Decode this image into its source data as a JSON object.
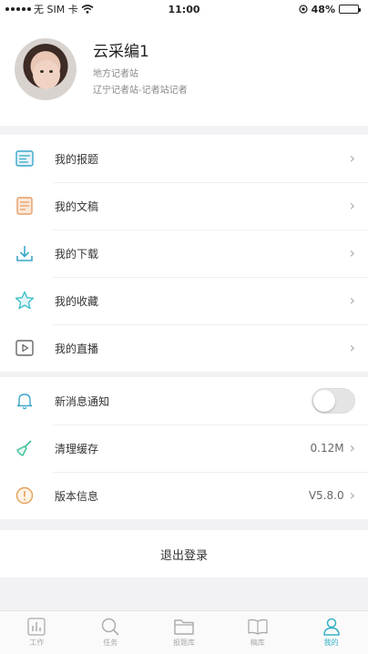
{
  "status_bar": {
    "carrier": "无 SIM 卡",
    "time": "11:00",
    "battery": "48%",
    "battery_level": 0.48
  },
  "profile": {
    "name": "云采编1",
    "org": "地方记者站",
    "role": "辽宁记者站-记者站记者"
  },
  "menu_primary": [
    {
      "label": "我的报题",
      "icon": "topic-icon",
      "color": "#3aa7c9"
    },
    {
      "label": "我的文稿",
      "icon": "document-icon",
      "color": "#e69e6a"
    },
    {
      "label": "我的下载",
      "icon": "download-icon",
      "color": "#3aa7c9"
    },
    {
      "label": "我的收藏",
      "icon": "star-icon",
      "color": "#3fbfc9"
    },
    {
      "label": "我的直播",
      "icon": "live-icon",
      "color": "#666666"
    }
  ],
  "menu_settings": [
    {
      "label": "新消息通知",
      "icon": "bell-icon",
      "toggle": false
    },
    {
      "label": "清理缓存",
      "icon": "broom-icon",
      "value": "0.12M"
    },
    {
      "label": "版本信息",
      "icon": "info-icon",
      "value": "V5.8.0"
    }
  ],
  "logout": "退出登录",
  "tabs": [
    {
      "label": "工作",
      "icon": "chart-icon",
      "active": false
    },
    {
      "label": "任务",
      "icon": "search-icon",
      "active": false
    },
    {
      "label": "报题库",
      "icon": "folder-icon",
      "active": false
    },
    {
      "label": "稿库",
      "icon": "book-icon",
      "active": false
    },
    {
      "label": "我的",
      "icon": "user-icon",
      "active": true
    }
  ],
  "colors": {
    "accent": "#34b1c8",
    "background": "#f2f2f4"
  }
}
